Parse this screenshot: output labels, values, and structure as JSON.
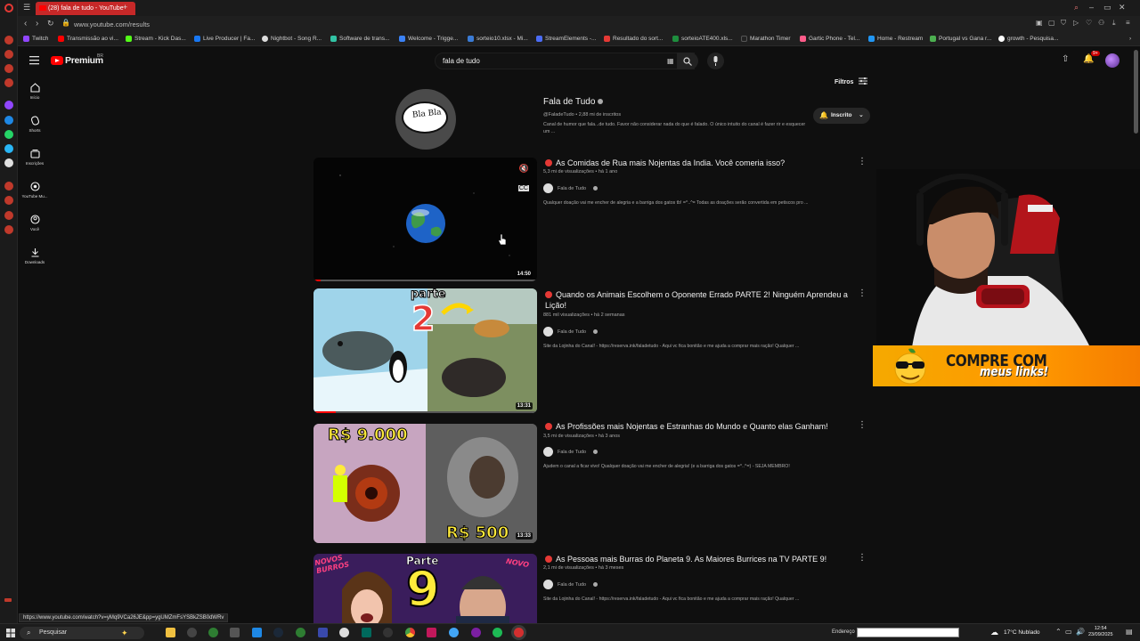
{
  "browser": {
    "active_tab_title": "(28) fala de tudo - YouTube",
    "url": "www.youtube.com/results",
    "bookmarks": [
      {
        "label": "Twitch",
        "color": "#9146ff"
      },
      {
        "label": "Transmissão ao vi...",
        "color": "#ff0000"
      },
      {
        "label": "Stream - Kick Das...",
        "color": "#53fc18"
      },
      {
        "label": "Live Producer | Fa...",
        "color": "#1877f2"
      },
      {
        "label": "Nightbot - Song R...",
        "color": "#dddddd"
      },
      {
        "label": "Software de trans...",
        "color": "#32c3a4"
      },
      {
        "label": "Welcome - Trigge...",
        "color": "#3b82f6"
      },
      {
        "label": "sorteio10.xlsx - Mi...",
        "color": "#3a7bd5"
      },
      {
        "label": "StreamElements -...",
        "color": "#4b6cf5"
      },
      {
        "label": "Resultado do sort...",
        "color": "#e53935"
      },
      {
        "label": "sorteioATE400.xls...",
        "color": "#1e8e3e"
      },
      {
        "label": "Marathon Timer",
        "color": "#222222"
      },
      {
        "label": "Gartic Phone - Tel...",
        "color": "#ff5c8a"
      },
      {
        "label": "Home - Restream",
        "color": "#2196f3"
      },
      {
        "label": "Portugal vs Gana r...",
        "color": "#4caf50"
      },
      {
        "label": "growth - Pesquisa...",
        "color": "#ffffff"
      }
    ]
  },
  "youtube": {
    "logo_text": "Premium",
    "logo_region": "BR",
    "search_query": "fala de tudo",
    "filters_label": "Filtros",
    "guide": [
      {
        "label": "Início",
        "icon": "home-icon"
      },
      {
        "label": "Shorts",
        "icon": "shorts-icon"
      },
      {
        "label": "Inscrições",
        "icon": "subscriptions-icon"
      },
      {
        "label": "YouTube Mu...",
        "icon": "music-icon"
      },
      {
        "label": "Você",
        "icon": "you-icon"
      },
      {
        "label": "Downloads",
        "icon": "download-icon"
      }
    ],
    "notifications_badge": "9+",
    "channel": {
      "name": "Fala de Tudo",
      "avatar_text": "Bla Bla",
      "handle_line": "@FaladeTudo • 2,88 mi de inscritos",
      "description": "Canal de humor que fala...de tudo. Favor não considerar nada do que é falado. O único intuito do canal é fazer rir e esquecer um ...",
      "subscribe_label": "Inscrito"
    },
    "videos": [
      {
        "title": "As Comidas de Rua mais Nojentas da India. Você comeria isso?",
        "meta": "5,3 mi de visualizações • há 1 ano",
        "channel": "Fala de Tudo",
        "description": "Qualquer doação vai me encher de alegria e a barriga dos gatos tb! =^..^= Todas as doações serão convertida em petiscos pro ...",
        "duration": "14:50"
      },
      {
        "title": "Quando os Animais Escolhem o Oponente Errado PARTE 2! Ninguém Aprendeu a Lição!",
        "meta": "881 mil visualizações • há 2 semanas",
        "channel": "Fala de Tudo",
        "description": "Site da Lojinha do Canal! - https://reserva.ink/faladetudo - Aqui vc fica bonitão e me ajuda a comprar mais ração! Qualquer ...",
        "duration": "13:31",
        "thumb_text": [
          "parte",
          "2"
        ]
      },
      {
        "title": "As Profissões mais Nojentas e Estranhas do Mundo e Quanto elas Ganham!",
        "meta": "3,5 mi de visualizações • há 3 anos",
        "channel": "Fala de Tudo",
        "description": "Ajudem o canal a ficar vivo! Qualquer doação vai me encher de alegria! (e a barriga dos gatos =^..^=) - SEJA MEMBRO!",
        "duration": "13:33",
        "thumb_text": [
          "R$ 9.000",
          "R$ 500"
        ]
      },
      {
        "title": "As Pessoas mais Burras do Planeta 9. As Maiores Burrices na TV PARTE 9!",
        "meta": "2,1 mi de visualizações • há 3 meses",
        "channel": "Fala de Tudo",
        "description": "Site da Lojinha do Canal! - https://reserva.ink/faladetudo - Aqui vc fica bonitão e me ajuda a comprar mais ração! Qualquer ...",
        "thumb_text": [
          "NOVOS BURROS",
          "Parte",
          "9",
          "NOVO"
        ]
      }
    ],
    "status_link": "https://www.youtube.com/watch?v=yMq9VCa26JE&pp=ygUMZmFsYSBkZSB0dWRv"
  },
  "overlay": {
    "promo_line1": "COMPRE COM",
    "promo_line2": "meus links!"
  },
  "taskbar": {
    "search_placeholder": "Pesquisar",
    "address_label": "Endereço",
    "weather": "17°C  Nublado",
    "time": "12:54",
    "date": "23/09/2025"
  }
}
